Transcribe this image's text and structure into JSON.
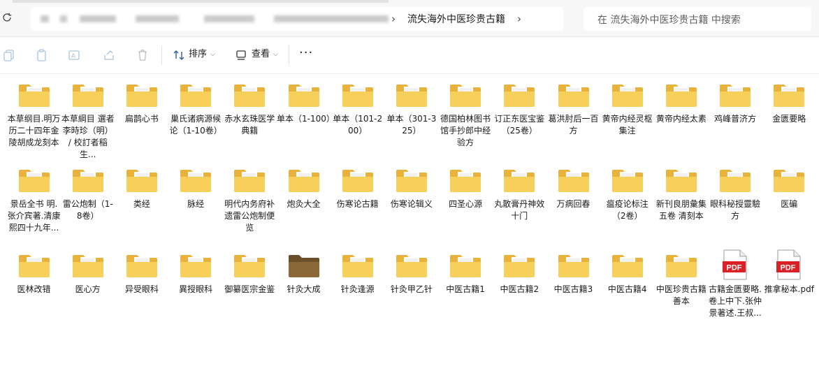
{
  "address": {
    "current_folder": "流失海外中医珍贵古籍",
    "search_placeholder": "在 流失海外中医珍贵古籍 中搜索"
  },
  "toolbar": {
    "sort_label": "排序",
    "view_label": "查看",
    "more_label": "···"
  },
  "files": [
    {
      "name": "本草纲目.明万历二十四年金陵胡成龙刻本",
      "type": "folder"
    },
    {
      "name": "本草綱目 選者李時珍（明） / 校訂者稲生...",
      "type": "folder"
    },
    {
      "name": "扁鹊心书",
      "type": "folder"
    },
    {
      "name": "巢氏诸病源候论（1-10卷）",
      "type": "folder"
    },
    {
      "name": "赤水玄珠医学典籍",
      "type": "folder"
    },
    {
      "name": "单本（1-100）",
      "type": "folder"
    },
    {
      "name": "单本（101-200）",
      "type": "folder"
    },
    {
      "name": "单本（301-325）",
      "type": "folder"
    },
    {
      "name": "德国柏林图书馆手抄郎中经验方",
      "type": "folder"
    },
    {
      "name": "订正东医宝鉴（25卷）",
      "type": "folder"
    },
    {
      "name": "葛洪肘后一百方",
      "type": "folder"
    },
    {
      "name": "黄帝内经灵枢集注",
      "type": "folder"
    },
    {
      "name": "黄帝内经太素",
      "type": "folder"
    },
    {
      "name": "鸡峰普济方",
      "type": "folder"
    },
    {
      "name": "金匮要略",
      "type": "folder"
    },
    {
      "name": "景岳全书 明.张介宾著.清康熙四十九年...",
      "type": "folder"
    },
    {
      "name": "雷公炮制（1-8卷）",
      "type": "folder"
    },
    {
      "name": "类经",
      "type": "folder"
    },
    {
      "name": "脉经",
      "type": "folder"
    },
    {
      "name": "明代内务府补遗雷公炮制便览",
      "type": "folder"
    },
    {
      "name": "炮灸大全",
      "type": "folder"
    },
    {
      "name": "伤寒论古籍",
      "type": "folder"
    },
    {
      "name": "伤寒论辑义",
      "type": "folder"
    },
    {
      "name": "四圣心源",
      "type": "folder"
    },
    {
      "name": "丸散膏丹神效十门",
      "type": "folder"
    },
    {
      "name": "万病回春",
      "type": "folder"
    },
    {
      "name": "瘟疫论标注（2卷）",
      "type": "folder"
    },
    {
      "name": "新刊良朋彙集五卷 清刻本",
      "type": "folder"
    },
    {
      "name": "眼科秘授靈驗方",
      "type": "folder"
    },
    {
      "name": "医碥",
      "type": "folder"
    },
    {
      "name": "医林改错",
      "type": "folder"
    },
    {
      "name": "医心方",
      "type": "folder"
    },
    {
      "name": "异受眼科",
      "type": "folder"
    },
    {
      "name": "異授眼科",
      "type": "folder"
    },
    {
      "name": "御纂医宗金鉴",
      "type": "folder"
    },
    {
      "name": "针灸大成",
      "type": "folder-dark"
    },
    {
      "name": "针灸逢源",
      "type": "folder"
    },
    {
      "name": "针灸甲乙针",
      "type": "folder"
    },
    {
      "name": "中医古籍1",
      "type": "folder"
    },
    {
      "name": "中医古籍2",
      "type": "folder"
    },
    {
      "name": "中医古籍3",
      "type": "folder"
    },
    {
      "name": "中医古籍4",
      "type": "folder"
    },
    {
      "name": "中医珍贵古籍善本",
      "type": "folder"
    },
    {
      "name": "古籍金匮要略.卷上中下.张仲景著述.王叔...",
      "type": "pdf",
      "badge": "PDF"
    },
    {
      "name": "推拿秘本.pdf",
      "type": "pdf",
      "badge": "PDF"
    }
  ]
}
